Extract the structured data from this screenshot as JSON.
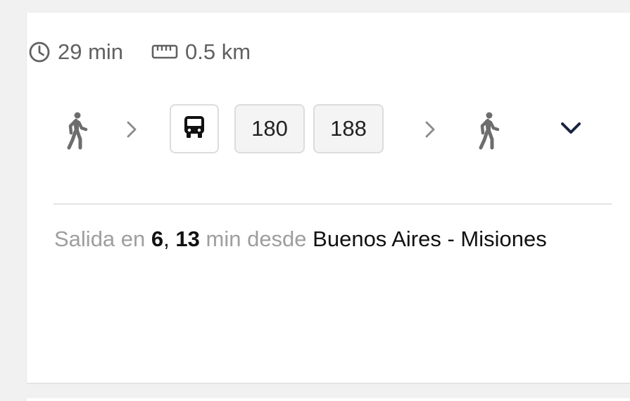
{
  "trip": {
    "duration": "29 min",
    "distance": "0.5 km"
  },
  "route": {
    "steps": [
      "walk",
      "bus",
      "walk"
    ],
    "lines": [
      "180",
      "188"
    ]
  },
  "departure": {
    "prefix": "Salida en",
    "time_1": "6",
    "separator": ",",
    "time_2": "13",
    "middle": "min desde",
    "stop_name": "Buenos Aires - Misiones"
  },
  "icons": {
    "clock": "clock-icon",
    "ruler": "ruler-icon",
    "walk": "walk-icon",
    "bus": "bus-icon",
    "chevron_right": "chevron-right-icon",
    "expand": "chevron-down-icon"
  },
  "colors": {
    "text_secondary": "#616161",
    "text_muted": "#9e9e9e",
    "text_primary": "#111111",
    "chip_border": "#dcdcdc",
    "expand_icon": "#1a2340"
  }
}
